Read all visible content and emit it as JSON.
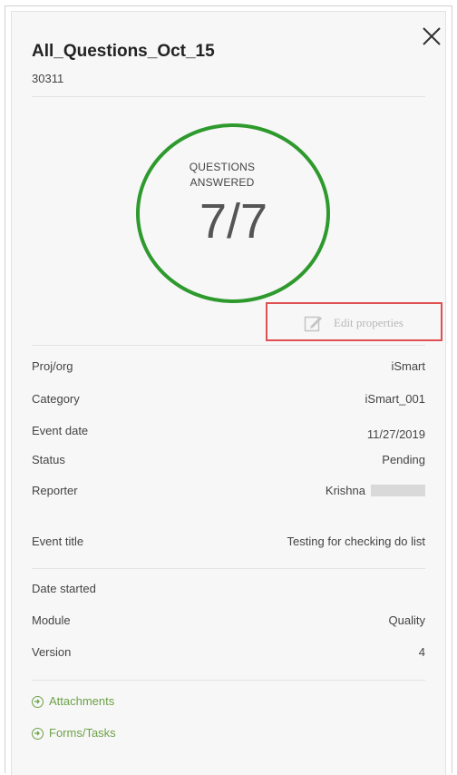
{
  "header": {
    "title": "All_Questions_Oct_15",
    "id": "30311"
  },
  "summary": {
    "label": "QUESTIONS ANSWERED",
    "value": "7/7",
    "ring_color": "#2e9a2e"
  },
  "actions": {
    "edit_label": "Edit properties"
  },
  "properties": [
    {
      "key": "Proj/org",
      "value": "iSmart"
    },
    {
      "key": "Category",
      "value": "iSmart_001"
    },
    {
      "key": "Event date",
      "value": "11/27/2019"
    },
    {
      "key": "Status",
      "value": "Pending"
    },
    {
      "key": "Reporter",
      "value": "Krishna"
    },
    {
      "key": "Event title",
      "value": "Testing for checking do list"
    }
  ],
  "details": [
    {
      "key": "Date started",
      "value": ""
    },
    {
      "key": "Module",
      "value": "Quality"
    },
    {
      "key": "Version",
      "value": "4"
    }
  ],
  "links": [
    {
      "label": "Attachments",
      "icon": "arrow-circle-icon"
    },
    {
      "label": "Forms/Tasks",
      "icon": "arrow-circle-icon"
    }
  ]
}
